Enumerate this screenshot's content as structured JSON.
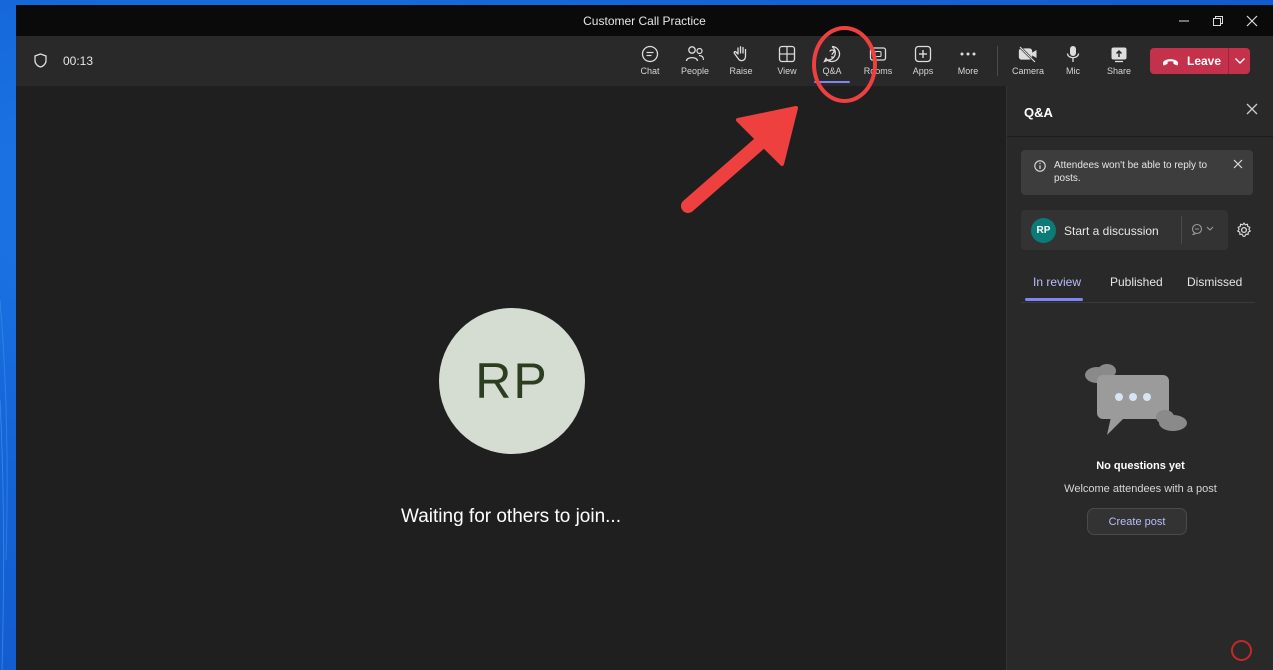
{
  "window": {
    "title": "Customer Call Practice"
  },
  "toolbar": {
    "timer": "00:13",
    "buttons": [
      {
        "label": "Chat",
        "icon": "chat-icon"
      },
      {
        "label": "People",
        "icon": "people-icon"
      },
      {
        "label": "Raise",
        "icon": "raise-hand-icon"
      },
      {
        "label": "View",
        "icon": "view-grid-icon"
      },
      {
        "label": "Q&A",
        "icon": "qa-icon",
        "active": true
      },
      {
        "label": "Rooms",
        "icon": "rooms-icon"
      },
      {
        "label": "Apps",
        "icon": "apps-icon"
      },
      {
        "label": "More",
        "icon": "more-icon"
      },
      {
        "label": "Camera",
        "icon": "camera-off-icon"
      },
      {
        "label": "Mic",
        "icon": "mic-icon"
      },
      {
        "label": "Share",
        "icon": "share-icon"
      }
    ],
    "leave_label": "Leave"
  },
  "stage": {
    "avatar_initials": "RP",
    "waiting_text": "Waiting for others to join..."
  },
  "panel": {
    "title": "Q&A",
    "banner_text": "Attendees won't be able to reply to posts.",
    "compose": {
      "avatar_initials": "RP",
      "placeholder": "Start a discussion"
    },
    "tabs": [
      "In review",
      "Published",
      "Dismissed"
    ],
    "empty": {
      "title": "No questions yet",
      "subtitle": "Welcome attendees with a post",
      "button": "Create post"
    }
  },
  "colors": {
    "accent": "#7f85f5",
    "leave": "#c4314b",
    "annotation": "#ef4040",
    "avatar_teal": "#0b7b78"
  }
}
